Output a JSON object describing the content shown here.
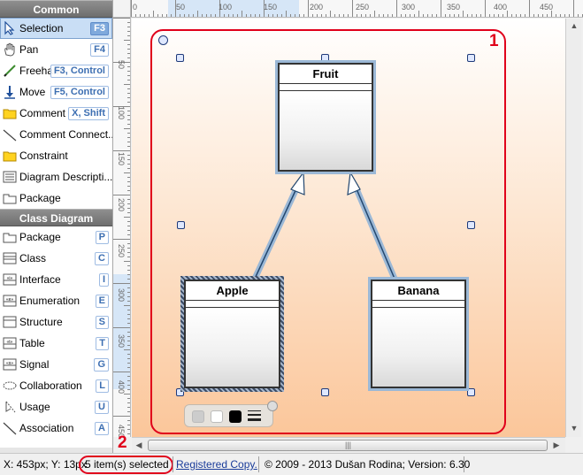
{
  "toolbox": {
    "sections": [
      {
        "title": "Common",
        "items": [
          {
            "label": "Selection",
            "shortcut": "F3",
            "icon": "pointer-icon",
            "selected": true
          },
          {
            "label": "Pan",
            "shortcut": "F4",
            "icon": "hand-icon"
          },
          {
            "label": "Freehand",
            "shortcut": "F3, Control",
            "icon": "pencil-icon"
          },
          {
            "label": "Move",
            "shortcut": "F5, Control",
            "icon": "move-arrow-icon"
          },
          {
            "label": "Comment",
            "shortcut": "X, Shift",
            "icon": "comment-folder-icon"
          },
          {
            "label": "Comment Connect...",
            "shortcut": "",
            "icon": "connector-line-icon"
          },
          {
            "label": "Constraint",
            "shortcut": "",
            "icon": "constraint-folder-icon"
          },
          {
            "label": "Diagram Descripti...",
            "shortcut": "",
            "icon": "description-icon"
          },
          {
            "label": "Package",
            "shortcut": "",
            "icon": "package-icon"
          }
        ]
      },
      {
        "title": "Class Diagram",
        "items": [
          {
            "label": "Package",
            "shortcut": "P",
            "icon": "package-icon"
          },
          {
            "label": "Class",
            "shortcut": "C",
            "icon": "class-icon"
          },
          {
            "label": "Interface",
            "shortcut": "I",
            "icon": "interface-icon"
          },
          {
            "label": "Enumeration",
            "shortcut": "E",
            "icon": "enumeration-icon"
          },
          {
            "label": "Structure",
            "shortcut": "S",
            "icon": "structure-icon"
          },
          {
            "label": "Table",
            "shortcut": "T",
            "icon": "table-icon"
          },
          {
            "label": "Signal",
            "shortcut": "G",
            "icon": "signal-icon"
          },
          {
            "label": "Collaboration",
            "shortcut": "L",
            "icon": "collaboration-icon"
          },
          {
            "label": "Usage",
            "shortcut": "U",
            "icon": "usage-icon"
          },
          {
            "label": "Association",
            "shortcut": "A",
            "icon": "association-icon"
          }
        ]
      }
    ]
  },
  "rulers": {
    "top_ticks": [
      "0",
      "50",
      "100",
      "150",
      "200",
      "250",
      "300",
      "350",
      "400",
      "450"
    ],
    "left_ticks": [
      "50",
      "100",
      "150",
      "200",
      "250",
      "300",
      "350",
      "400",
      "450"
    ]
  },
  "diagram": {
    "classes": {
      "fruit": "Fruit",
      "apple": "Apple",
      "banana": "Banana"
    },
    "annotations": {
      "canvas_marker": "1",
      "status_marker": "2"
    },
    "palette_colors": [
      "#cccccc",
      "#ffffff",
      "#000000"
    ]
  },
  "statusbar": {
    "coords": "X: 453px; Y: 13px",
    "selection": "5 item(s) selected",
    "registration": "Registered Copy.",
    "copyright": "© 2009 - 2013 Dušan Rodina; Version: 6.30"
  }
}
